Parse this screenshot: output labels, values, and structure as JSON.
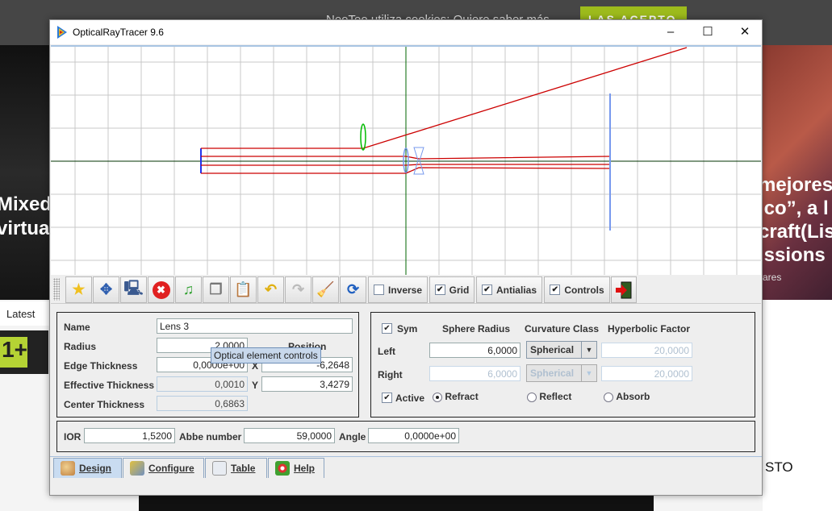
{
  "background": {
    "cookie_text": "NeoTeo utiliza cookies: Quiere saber más",
    "accept_label": "LAS ACEPTO",
    "left_lines": [
      "Mixed",
      "virtual"
    ],
    "latest_label": "Latest",
    "badge": "1+",
    "right_lines": [
      "mejores",
      "ico”, a l",
      "craft(Lis",
      "issions"
    ],
    "right_small": "ares",
    "right_bottom": "STO"
  },
  "window": {
    "title": "OpticalRayTracer 9.6",
    "minimize": "–",
    "maximize": "☐",
    "close": "✕"
  },
  "toolbar": {
    "buttons": [
      {
        "name": "new-element",
        "icon": "star-icon"
      },
      {
        "name": "move",
        "icon": "move-arrows-icon"
      },
      {
        "name": "delete-network",
        "icon": "computer-delete-icon"
      },
      {
        "name": "delete",
        "icon": "red-x-icon"
      },
      {
        "name": "media",
        "icon": "film-music-icon"
      },
      {
        "name": "copy",
        "icon": "copy-icon"
      },
      {
        "name": "paste",
        "icon": "clipboard-icon"
      },
      {
        "name": "undo",
        "icon": "undo-icon"
      },
      {
        "name": "redo",
        "icon": "redo-icon",
        "disabled": true
      },
      {
        "name": "clear",
        "icon": "broom-icon"
      },
      {
        "name": "refresh",
        "icon": "refresh-icon"
      }
    ],
    "toggles": [
      {
        "label": "Inverse",
        "checked": false
      },
      {
        "label": "Grid",
        "checked": true
      },
      {
        "label": "Antialias",
        "checked": true
      },
      {
        "label": "Controls",
        "checked": true
      }
    ],
    "exit_icon": "exit-door-icon"
  },
  "element": {
    "name_label": "Name",
    "name_value": "Lens 3",
    "radius_label": "Radius",
    "radius_value": "2,0000",
    "position_label": "Position",
    "edge_label": "Edge Thickness",
    "edge_value": "0,0000e+00",
    "x_label": "X",
    "x_value": "-6,2648",
    "eff_label": "Effective Thickness",
    "eff_value": "0,0010",
    "y_label": "Y",
    "y_value": "3,4279",
    "center_label": "Center Thickness",
    "center_value": "0,6863"
  },
  "tooltip": "Optical element controls",
  "surface": {
    "sym_label": "Sym",
    "sym_checked": true,
    "sphere_header": "Sphere Radius",
    "curv_header": "Curvature Class",
    "hyper_header": "Hyperbolic Factor",
    "left_label": "Left",
    "left_radius": "6,0000",
    "left_class": "Spherical",
    "left_hyper": "20,0000",
    "right_label": "Right",
    "right_radius": "6,0000",
    "right_class": "Spherical",
    "right_hyper": "20,0000",
    "active_label": "Active",
    "active_checked": true,
    "mode_options": [
      "Refract",
      "Reflect",
      "Absorb"
    ],
    "mode_selected": "Refract"
  },
  "material": {
    "ior_label": "IOR",
    "ior_value": "1,5200",
    "abbe_label": "Abbe number",
    "abbe_value": "59,0000",
    "angle_label": "Angle",
    "angle_value": "0,0000e+00"
  },
  "tabs": [
    {
      "label": "Design",
      "icon": "palette-icon",
      "selected": true
    },
    {
      "label": "Configure",
      "icon": "tools-icon"
    },
    {
      "label": "Table",
      "icon": "table-icon"
    },
    {
      "label": "Help",
      "icon": "lifebuoy-icon"
    }
  ],
  "colors": {
    "ray": "#cc0000",
    "lens_selected": "#7799ee",
    "lens_other": "#00bb00",
    "axis": "#003300",
    "grid": "#c8c8c8",
    "tab_selected": "#c9dcf1"
  }
}
